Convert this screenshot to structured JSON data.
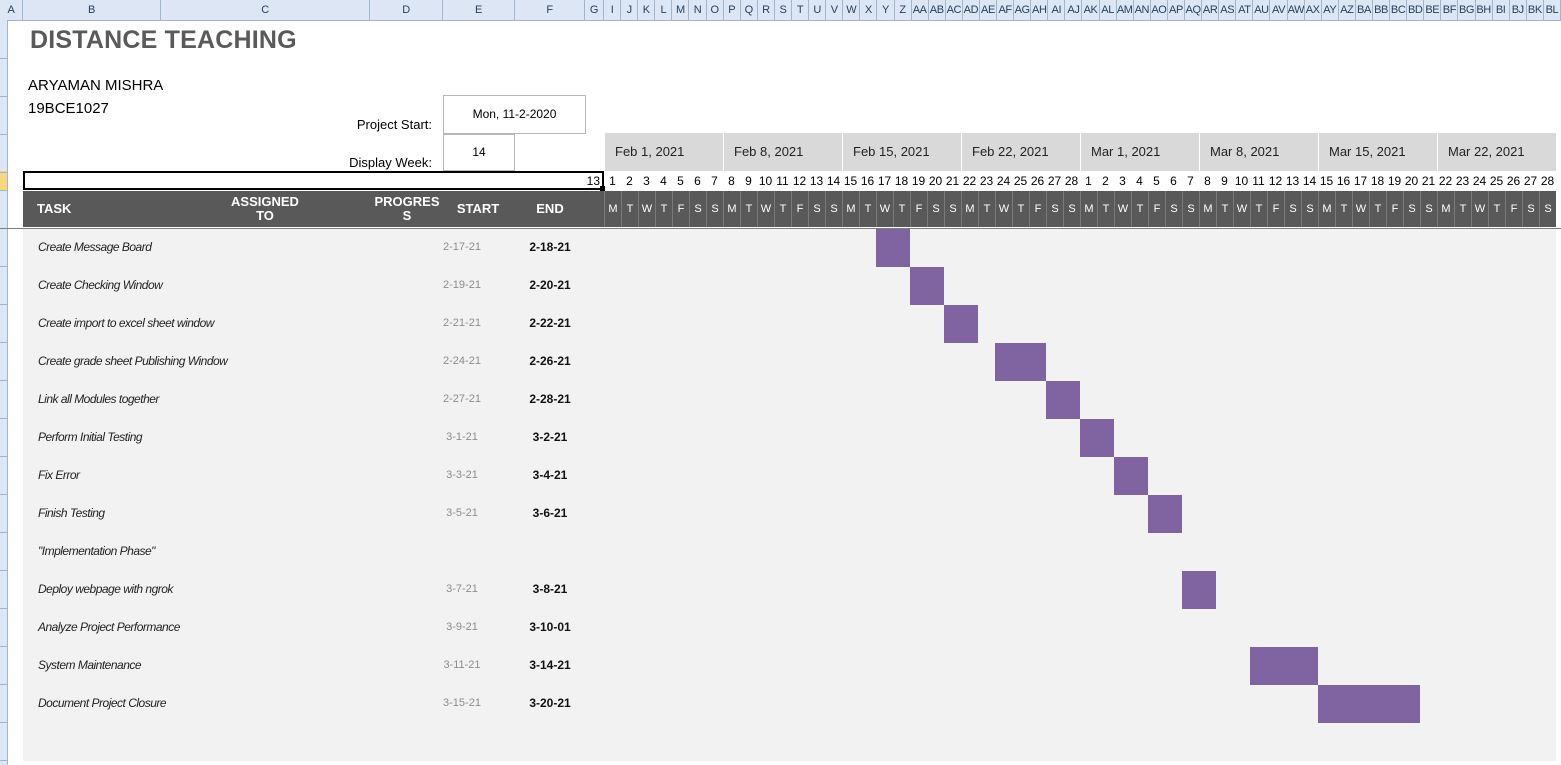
{
  "column_letters": [
    "A",
    "B",
    "C",
    "D",
    "E",
    "F",
    "G",
    "I",
    "J",
    "K",
    "L",
    "M",
    "N",
    "O",
    "P",
    "Q",
    "R",
    "S",
    "T",
    "U",
    "V",
    "W",
    "X",
    "Y",
    "Z",
    "AA",
    "AB",
    "AC",
    "AD",
    "AE",
    "AF",
    "AG",
    "AH",
    "AI",
    "AJ",
    "AK",
    "AL",
    "AM",
    "AN",
    "AO",
    "AP",
    "AQ",
    "AR",
    "AS",
    "AT",
    "AU",
    "AV",
    "AW",
    "AX",
    "AY",
    "AZ",
    "BA",
    "BB",
    "BC",
    "BD",
    "BE",
    "BF",
    "BG",
    "BH",
    "BI",
    "BJ",
    "BK",
    "BL"
  ],
  "sheet": {
    "title": "DISTANCE TEACHING",
    "author": "ARYAMAN MISHRA",
    "reg_no": "19BCE1027",
    "project_start_label": "Project Start:",
    "project_start_value": "Mon, 11-2-2020",
    "display_week_label": "Display Week:",
    "display_week_value": "14",
    "active_cell_value": "13"
  },
  "weeks": [
    "Feb 1, 2021",
    "Feb 8, 2021",
    "Feb 15, 2021",
    "Feb 22, 2021",
    "Mar 1, 2021",
    "Mar 8, 2021",
    "Mar 15, 2021",
    "Mar 22, 2021"
  ],
  "day_numbers": [
    "1",
    "2",
    "3",
    "4",
    "5",
    "6",
    "7",
    "8",
    "9",
    "10",
    "11",
    "12",
    "13",
    "14",
    "15",
    "16",
    "17",
    "18",
    "19",
    "20",
    "21",
    "22",
    "23",
    "24",
    "25",
    "26",
    "27",
    "28",
    "1",
    "2",
    "3",
    "4",
    "5",
    "6",
    "7",
    "8",
    "9",
    "10",
    "11",
    "12",
    "13",
    "14",
    "15",
    "16",
    "17",
    "18",
    "19",
    "20",
    "21",
    "22",
    "23",
    "24",
    "25",
    "26",
    "27",
    "28"
  ],
  "day_letters": [
    "M",
    "T",
    "W",
    "T",
    "F",
    "S",
    "S"
  ],
  "headers": {
    "task": "TASK",
    "assigned_line1": "ASSIGNED",
    "assigned_line2": "TO",
    "progress_line1": "PROGRES",
    "progress_line2": "S",
    "start": "START",
    "end": "END"
  },
  "tasks": [
    {
      "name": "Create Message Board",
      "start": "2-17-21",
      "end": "2-18-21",
      "bar": [
        16,
        2
      ]
    },
    {
      "name": "Create Checking Window",
      "start": "2-19-21",
      "end": "2-20-21",
      "bar": [
        18,
        2
      ]
    },
    {
      "name": "Create import to excel sheet window",
      "start": "2-21-21",
      "end": "2-22-21",
      "bar": [
        20,
        2
      ]
    },
    {
      "name": "Create grade sheet Publishing Window",
      "start": "2-24-21",
      "end": "2-26-21",
      "bar": [
        23,
        3
      ]
    },
    {
      "name": "Link all Modules together",
      "start": "2-27-21",
      "end": "2-28-21",
      "bar": [
        26,
        2
      ]
    },
    {
      "name": "Perform Initial Testing",
      "start": "3-1-21",
      "end": "3-2-21",
      "bar": [
        28,
        2
      ]
    },
    {
      "name": "Fix Error",
      "start": "3-3-21",
      "end": "3-4-21",
      "bar": [
        30,
        2
      ]
    },
    {
      "name": "Finish Testing",
      "start": "3-5-21",
      "end": "3-6-21",
      "bar": [
        32,
        2
      ]
    },
    {
      "name": "\"Implementation Phase\"",
      "start": "",
      "end": "",
      "bar": null
    },
    {
      "name": "Deploy webpage with ngrok",
      "start": "3-7-21",
      "end": "3-8-21",
      "bar": [
        34,
        2
      ]
    },
    {
      "name": "Analyze Project Performance",
      "start": "3-9-21",
      "end": "3-10-01",
      "bar": null
    },
    {
      "name": "System Maintenance",
      "start": "3-11-21",
      "end": "3-14-21",
      "bar": [
        38,
        4
      ]
    },
    {
      "name": "Document Project Closure",
      "start": "3-15-21",
      "end": "3-20-21",
      "bar": [
        42,
        6
      ]
    }
  ],
  "colors": {
    "bar": "#8064a2",
    "header_bar": "#595959",
    "week_band": "#d9d9d9",
    "body": "#f2f2f2"
  }
}
